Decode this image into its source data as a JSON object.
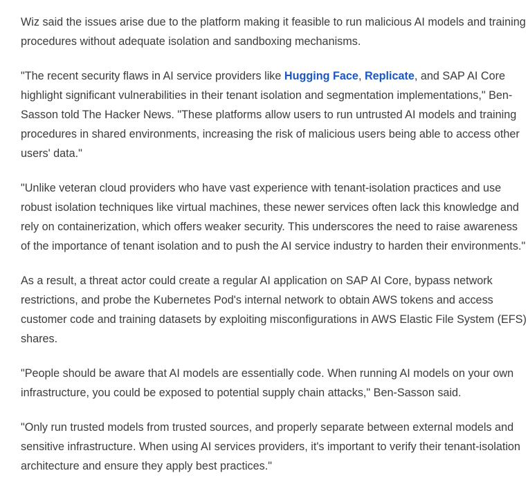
{
  "article": {
    "p1": "Wiz said the issues arise due to the platform making it feasible to run malicious AI models and training procedures without adequate isolation and sandboxing mechanisms.",
    "p2": {
      "before": "\"The recent security flaws in AI service providers like ",
      "link1": "Hugging Face",
      "sep": ", ",
      "link2": "Replicate",
      "after": ", and SAP AI Core highlight significant vulnerabilities in their tenant isolation and segmentation implementations,\" Ben-Sasson told The Hacker News. \"These platforms allow users to run untrusted AI models and training procedures in shared environments, increasing the risk of malicious users being able to access other users' data.\""
    },
    "p3": "\"Unlike veteran cloud providers who have vast experience with tenant-isolation practices and use robust isolation techniques like virtual machines, these newer services often lack this knowledge and rely on containerization, which offers weaker security. This underscores the need to raise awareness of the importance of tenant isolation and to push the AI service industry to harden their environments.\"",
    "p4": "As a result, a threat actor could create a regular AI application on SAP AI Core, bypass network restrictions, and probe the Kubernetes Pod's internal network to obtain AWS tokens and access customer code and training datasets by exploiting misconfigurations in AWS Elastic File System (EFS) shares.",
    "p5": "\"People should be aware that AI models are essentially code. When running AI models on your own infrastructure, you could be exposed to potential supply chain attacks,\" Ben-Sasson said.",
    "p6": "\"Only run trusted models from trusted sources, and properly separate between external models and sensitive infrastructure. When using AI services providers, it's important to verify their tenant-isolation architecture and ensure they apply best practices.\""
  },
  "colors": {
    "text": "#3b3b3b",
    "link": "#1a56c4",
    "background": "#ffffff"
  }
}
